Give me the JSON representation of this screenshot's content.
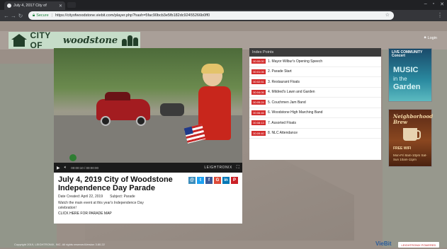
{
  "browser": {
    "tab_title": "July 4, 2017 City of",
    "secure_label": "Secure",
    "url": "https://cityofwoodstone.viebit.com/player.php?hash=5fac90bcb3e5fb182dc92455266b0ff0"
  },
  "site": {
    "logo_text": "CITY OF",
    "logo_script": "woodstone",
    "login_label": "Login"
  },
  "player": {
    "timecode": "00:00:10 / 00:00:00",
    "brand": "LEIGHTRONIX"
  },
  "event": {
    "title": "July 4, 2019 City of Woodstone Independence Day Parade",
    "date_created": "Date Created: April 22, 2019",
    "subject": "Subject: Parade",
    "description": "Watch the main event at this year's Independence Day celebration!",
    "map_link": "CLICK HERE FOR PARADE MAP"
  },
  "share": [
    {
      "name": "email",
      "glyph": "@",
      "color": "#3c8dbc"
    },
    {
      "name": "twitter",
      "glyph": "t",
      "color": "#1da1f2"
    },
    {
      "name": "facebook",
      "glyph": "f",
      "color": "#3b5998"
    },
    {
      "name": "google",
      "glyph": "G",
      "color": "#dd4b39"
    },
    {
      "name": "linkedin",
      "glyph": "in",
      "color": "#0077b5"
    },
    {
      "name": "pinterest",
      "glyph": "P",
      "color": "#cb2027"
    }
  ],
  "index_points": {
    "header": "Index Points",
    "items": [
      {
        "time": "00:00:00",
        "label": "1. Mayor Wilbur's Opening Speech"
      },
      {
        "time": "00:01:06",
        "label": "2. Parade Start"
      },
      {
        "time": "00:02:51",
        "label": "3. Restaurant Floats"
      },
      {
        "time": "00:04:06",
        "label": "4. Mildred's Lawn and Garden"
      },
      {
        "time": "00:05:24",
        "label": "5. Couchmen Jam Band"
      },
      {
        "time": "00:06:46",
        "label": "6. Woodstone High Marching Band"
      },
      {
        "time": "00:08:13",
        "label": "7. Assorted Floats"
      },
      {
        "time": "00:09:40",
        "label": "8. NLC Attendance"
      }
    ]
  },
  "ads": {
    "concert": {
      "line1": "LIVE COMMUNITY",
      "line2": "Concert",
      "big1": "MUSIC",
      "mid": "in the",
      "big2": "Garden"
    },
    "brew": {
      "title": "Neighborhood Brew",
      "tag": "FREE WIFI",
      "hours": "Mon-Fri 8am-10pm Sat-Sun 10am-11pm"
    }
  },
  "footer": {
    "copyright": "Copyright 2019, LEIGHTRONIX, INC. All rights reserved.",
    "version": "Version 3.80.22",
    "viebit": "VieBit",
    "badge": "LEIGHTRONIX POWERED"
  },
  "colors": {
    "accent": "#d32f2f",
    "logo_bg": "#c6ddc9",
    "logo_fg": "#233f2a"
  }
}
